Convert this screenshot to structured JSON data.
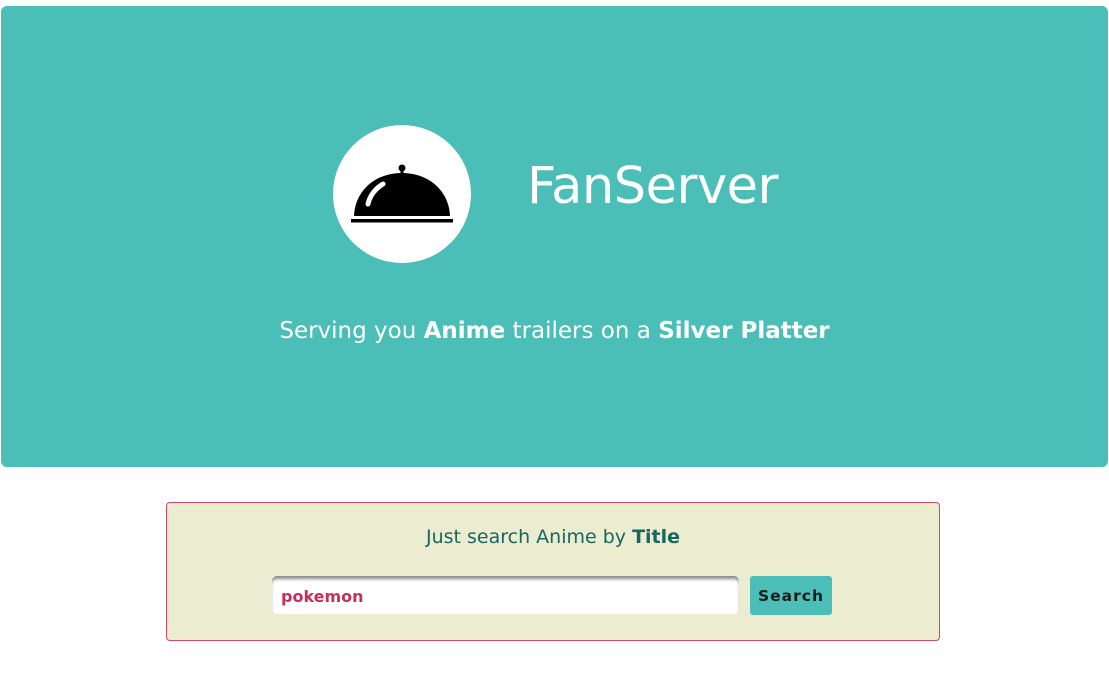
{
  "hero": {
    "brand_name": "FanServer",
    "logo_icon": "serving-cloche-icon",
    "tagline": {
      "part1": "Serving you ",
      "highlight1": "Anime",
      "part2": " trailers on a ",
      "highlight2": "Silver Platter"
    }
  },
  "search": {
    "heading": {
      "text": "Just search Anime by ",
      "highlight": "Title"
    },
    "input_value": "pokemon",
    "button_label": "Search"
  },
  "colors": {
    "brand_teal": "#4abeb7",
    "panel_background": "#ecedd0",
    "panel_border": "#d4486b",
    "heading_text": "#17665f",
    "input_text": "#c4305a"
  }
}
